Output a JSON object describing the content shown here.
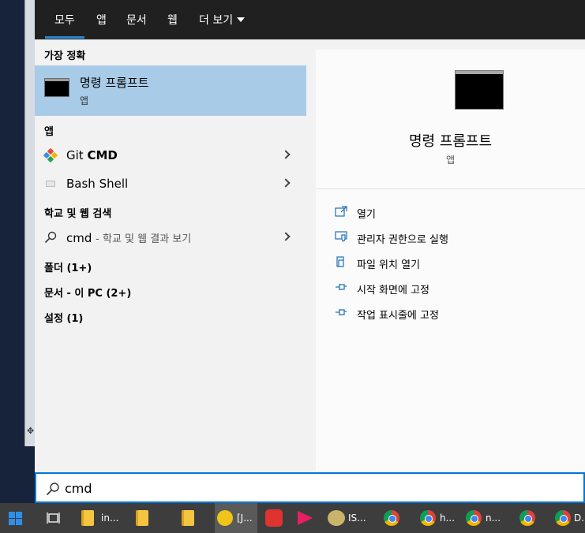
{
  "tabs": [
    {
      "label": "모두",
      "active": true
    },
    {
      "label": "앱"
    },
    {
      "label": "문서"
    },
    {
      "label": "웹"
    },
    {
      "label": "더 보기"
    }
  ],
  "sections": {
    "best_match": "가장 정확",
    "apps": "앱",
    "web": "학교 및 웹 검색",
    "folders": "폴더 (1+)",
    "documents": "문서 - 이 PC (2+)",
    "settings": "설정 (1)"
  },
  "best_match": {
    "name": "명령 프롬프트",
    "type": "앱",
    "icon": "command-prompt-icon"
  },
  "apps": [
    {
      "name_prefix": "Git ",
      "name_bold": "CMD",
      "icon": "git-icon"
    },
    {
      "name_prefix": "Bash Shell",
      "name_bold": "",
      "icon": "bash-icon"
    }
  ],
  "web_result": {
    "query": "cmd",
    "hint": "- 학교 및 웹 결과 보기",
    "icon": "search-icon"
  },
  "detail": {
    "title": "명령 프롬프트",
    "subtitle": "앱",
    "actions": [
      {
        "label": "열기",
        "icon": "open-icon"
      },
      {
        "label": "관리자 권한으로 실행",
        "icon": "shield-icon"
      },
      {
        "label": "파일 위치 열기",
        "icon": "file-location-icon"
      },
      {
        "label": "시작 화면에 고정",
        "icon": "pin-icon"
      },
      {
        "label": "작업 표시줄에 고정",
        "icon": "pin-icon"
      }
    ]
  },
  "search": {
    "value": "cmd"
  },
  "taskbar": {
    "items": [
      {
        "icon": "windows-start-icon",
        "label": ""
      },
      {
        "icon": "task-view-icon",
        "label": ""
      },
      {
        "icon": "folder-icon",
        "label": "in..."
      },
      {
        "icon": "folder-icon",
        "label": ""
      },
      {
        "icon": "folder-icon",
        "label": ""
      },
      {
        "icon": "media-player-icon",
        "label": "[J..."
      },
      {
        "icon": "screen-recorder-icon",
        "label": ""
      },
      {
        "icon": "play-app-icon",
        "label": ""
      },
      {
        "icon": "paint-icon",
        "label": "IS..."
      },
      {
        "icon": "chrome-icon",
        "label": ""
      },
      {
        "icon": "chrome-icon",
        "label": "h..."
      },
      {
        "icon": "chrome-icon",
        "label": "n..."
      },
      {
        "icon": "chrome-icon",
        "label": ""
      },
      {
        "icon": "chrome-icon",
        "label": "D..."
      }
    ]
  },
  "colors": {
    "accent": "#0078d7",
    "tab_underline": "#2b88d8",
    "selected_bg": "#a8cbe8",
    "tabbar_bg": "#202020",
    "taskbar_bg": "#3d3d3d"
  }
}
